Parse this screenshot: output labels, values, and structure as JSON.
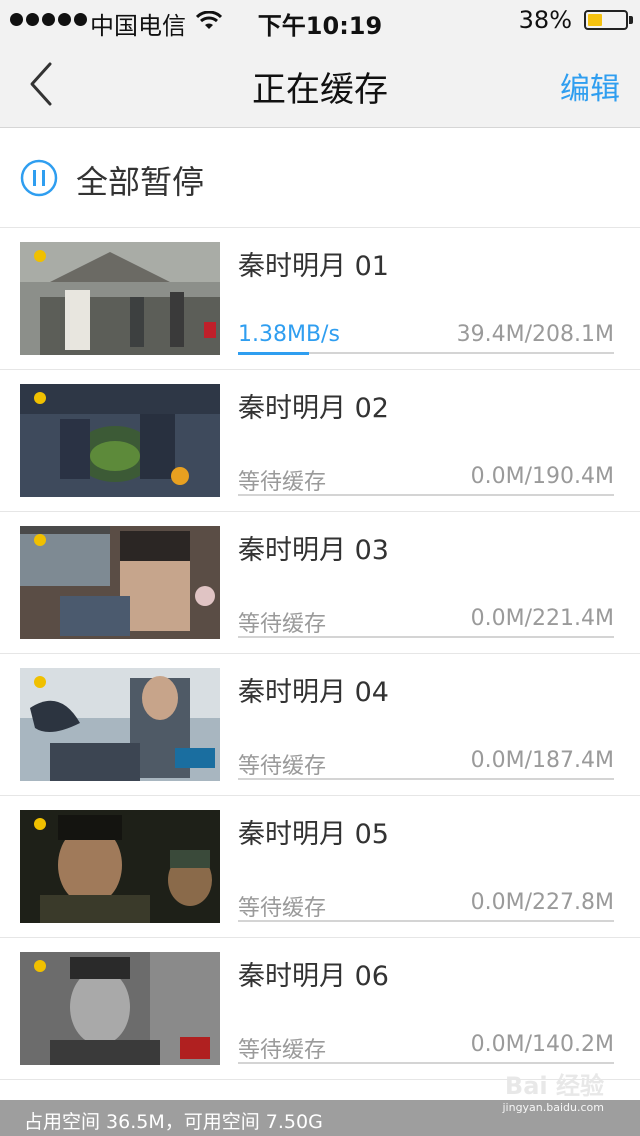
{
  "status_bar": {
    "carrier": "中国电信",
    "time": "下午10:19",
    "battery": "38%",
    "battery_level": 0.38,
    "battery_color": "#f4c10f"
  },
  "nav": {
    "back_icon": "chevron-left-icon",
    "title": "正在缓存",
    "edit_label": "编辑",
    "accent_color": "#2f9ef0"
  },
  "pause_all": {
    "icon": "pause-circle-icon",
    "label": "全部暂停"
  },
  "downloads": [
    {
      "title": "秦时明月 01",
      "status": "1.38MB/s",
      "size": "39.4M/208.1M",
      "progress": 0.19,
      "active": true
    },
    {
      "title": "秦时明月 02",
      "status": "等待缓存",
      "size": "0.0M/190.4M",
      "progress": 0,
      "active": false
    },
    {
      "title": "秦时明月 03",
      "status": "等待缓存",
      "size": "0.0M/221.4M",
      "progress": 0,
      "active": false
    },
    {
      "title": "秦时明月 04",
      "status": "等待缓存",
      "size": "0.0M/187.4M",
      "progress": 0,
      "active": false
    },
    {
      "title": "秦时明月 05",
      "status": "等待缓存",
      "size": "0.0M/227.8M",
      "progress": 0,
      "active": false
    },
    {
      "title": "秦时明月 06",
      "status": "等待缓存",
      "size": "0.0M/140.2M",
      "progress": 0,
      "active": false
    }
  ],
  "storage": {
    "text": "占用空间 36.5M，可用空间 7.50G"
  },
  "watermark": {
    "text": "Bai 经验",
    "sub": "jingyan.baidu.com"
  }
}
